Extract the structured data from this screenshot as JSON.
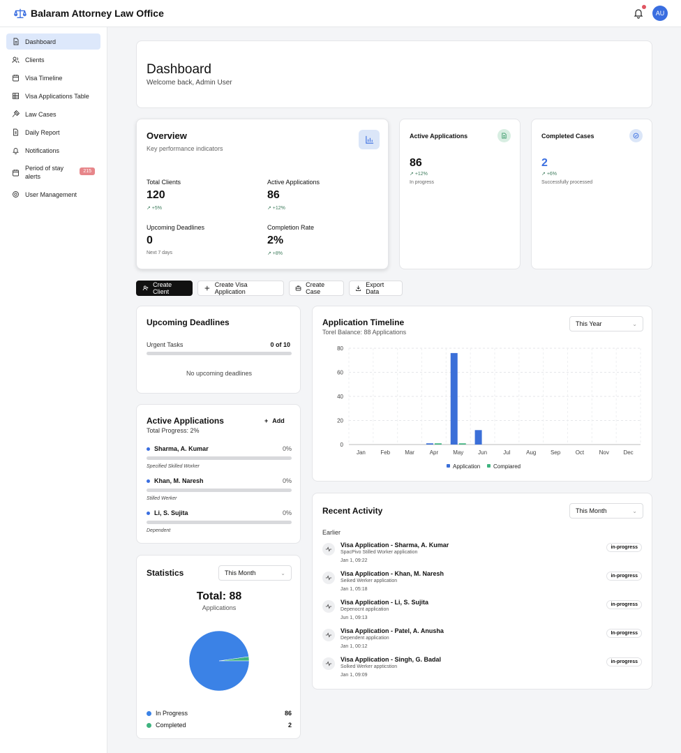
{
  "app": {
    "title": "Balaram Attorney Law Office",
    "avatar_initials": "AU"
  },
  "sidebar": {
    "items": [
      {
        "label": "Dashboard",
        "icon": "document-icon",
        "active": true
      },
      {
        "label": "Clients",
        "icon": "users-icon"
      },
      {
        "label": "Visa Timeline",
        "icon": "calendar-icon"
      },
      {
        "label": "Visa Applications Table",
        "icon": "table-icon"
      },
      {
        "label": "Law Cases",
        "icon": "gavel-icon"
      },
      {
        "label": "Daily Report",
        "icon": "report-icon"
      },
      {
        "label": "Notifications",
        "icon": "bell-icon"
      },
      {
        "label": "Period of stay alerts",
        "icon": "calendar-icon",
        "badge": "215"
      },
      {
        "label": "User Management",
        "icon": "gear-icon"
      }
    ]
  },
  "header": {
    "title": "Dashboard",
    "subtitle": "Welcome back, Admin User"
  },
  "overview": {
    "title": "Overview",
    "subtitle": "Key performance indicators",
    "stats": [
      {
        "label": "Total Clients",
        "value": "120",
        "note": "+5%"
      },
      {
        "label": "Active Applications",
        "value": "86",
        "note": "+12%"
      },
      {
        "label": "Upcoming Deadlines",
        "value": "0",
        "note": "Next 7 days"
      },
      {
        "label": "Completion Rate",
        "value": "2%",
        "note": "+8%"
      }
    ]
  },
  "active_card": {
    "title": "Active Applications",
    "value": "86",
    "trend": "+12%",
    "note": "In progress",
    "accent": "#3a9a6a"
  },
  "completed_card": {
    "title": "Completed Cases",
    "value": "2",
    "trend": "+6%",
    "note": "Successfully processed",
    "accent": "#3a6ee0"
  },
  "actions": {
    "create_client": "Create Client",
    "create_visa": "Create Visa Application",
    "create_case": "Create Case",
    "export": "Export Data"
  },
  "deadlines": {
    "title": "Upcoming Deadlines",
    "urgent_label": "Urgent Tasks",
    "urgent_count": "0 of 10",
    "progress": 0,
    "empty": "No upcoming deadlines"
  },
  "active_apps": {
    "title": "Active Applications",
    "add_label": "Add",
    "total_progress": "Total Progress: 2%",
    "items": [
      {
        "name": "Sharma, A. Kumar",
        "percent": "0%",
        "type": "Specified Skilled Worker"
      },
      {
        "name": "Khan, M. Naresh",
        "percent": "0%",
        "type": "Stilled Werker"
      },
      {
        "name": "Li, S. Sujita",
        "percent": "0%",
        "type": "Dependent"
      }
    ]
  },
  "statistics": {
    "title": "Statistics",
    "filter": "This Month",
    "total_label": "Total: 88",
    "total_sub": "Applications",
    "legend": [
      {
        "label": "In Progress",
        "value": "86",
        "color": "#3b82e6"
      },
      {
        "label": "Completed",
        "value": "2",
        "color": "#3fb37f"
      }
    ]
  },
  "timeline": {
    "title": "Application Timeline",
    "subtitle": "Torel Balance: 88 Applications",
    "filter": "This Year",
    "legend": [
      "Application",
      "Compiared"
    ]
  },
  "chart_data": {
    "type": "bar",
    "categories": [
      "Jan",
      "Feb",
      "Mar",
      "Apr",
      "May",
      "Jun",
      "Jul",
      "Aug",
      "Sep",
      "Oct",
      "Nov",
      "Dec"
    ],
    "series": [
      {
        "name": "Application",
        "values": [
          0,
          0,
          0,
          1,
          76,
          12,
          0,
          0,
          0,
          0,
          0,
          0
        ],
        "color": "#3b6fd8"
      },
      {
        "name": "Compiared",
        "values": [
          0,
          0,
          0,
          1,
          1,
          0,
          0,
          0,
          0,
          0,
          0,
          0
        ],
        "color": "#3fb37f"
      }
    ],
    "y_ticks": [
      0,
      20,
      40,
      60,
      80
    ],
    "ylim": [
      0,
      80
    ],
    "grid": true,
    "legend_position": "bottom"
  },
  "recent": {
    "title": "Recent Activity",
    "filter": "This Month",
    "group": "Earlier",
    "items": [
      {
        "title": "Visa Application - Sharma, A. Kumar",
        "sub": "SpacPivo Stilled Worker application",
        "time": "Jan 1, 09:22",
        "status": "in-progress"
      },
      {
        "title": "Visa Application - Khan, M. Naresh",
        "sub": "Seiked Werker application",
        "time": "Jan 1, 05:18",
        "status": "in-progress"
      },
      {
        "title": "Visa Application - Li, S. Sujita",
        "sub": "Depenocnt application",
        "time": "Jun 1, 09:13",
        "status": "in-progress"
      },
      {
        "title": "Visa Application - Patel, A. Anusha",
        "sub": "Dependent application",
        "time": "Jan 1, 00:12",
        "status": "In-progress"
      },
      {
        "title": "Visa Application - Singh, G. Badal",
        "sub": "Solked Werker appticstion",
        "time": "Jan 1, 09:09",
        "status": "in-progress"
      }
    ]
  }
}
